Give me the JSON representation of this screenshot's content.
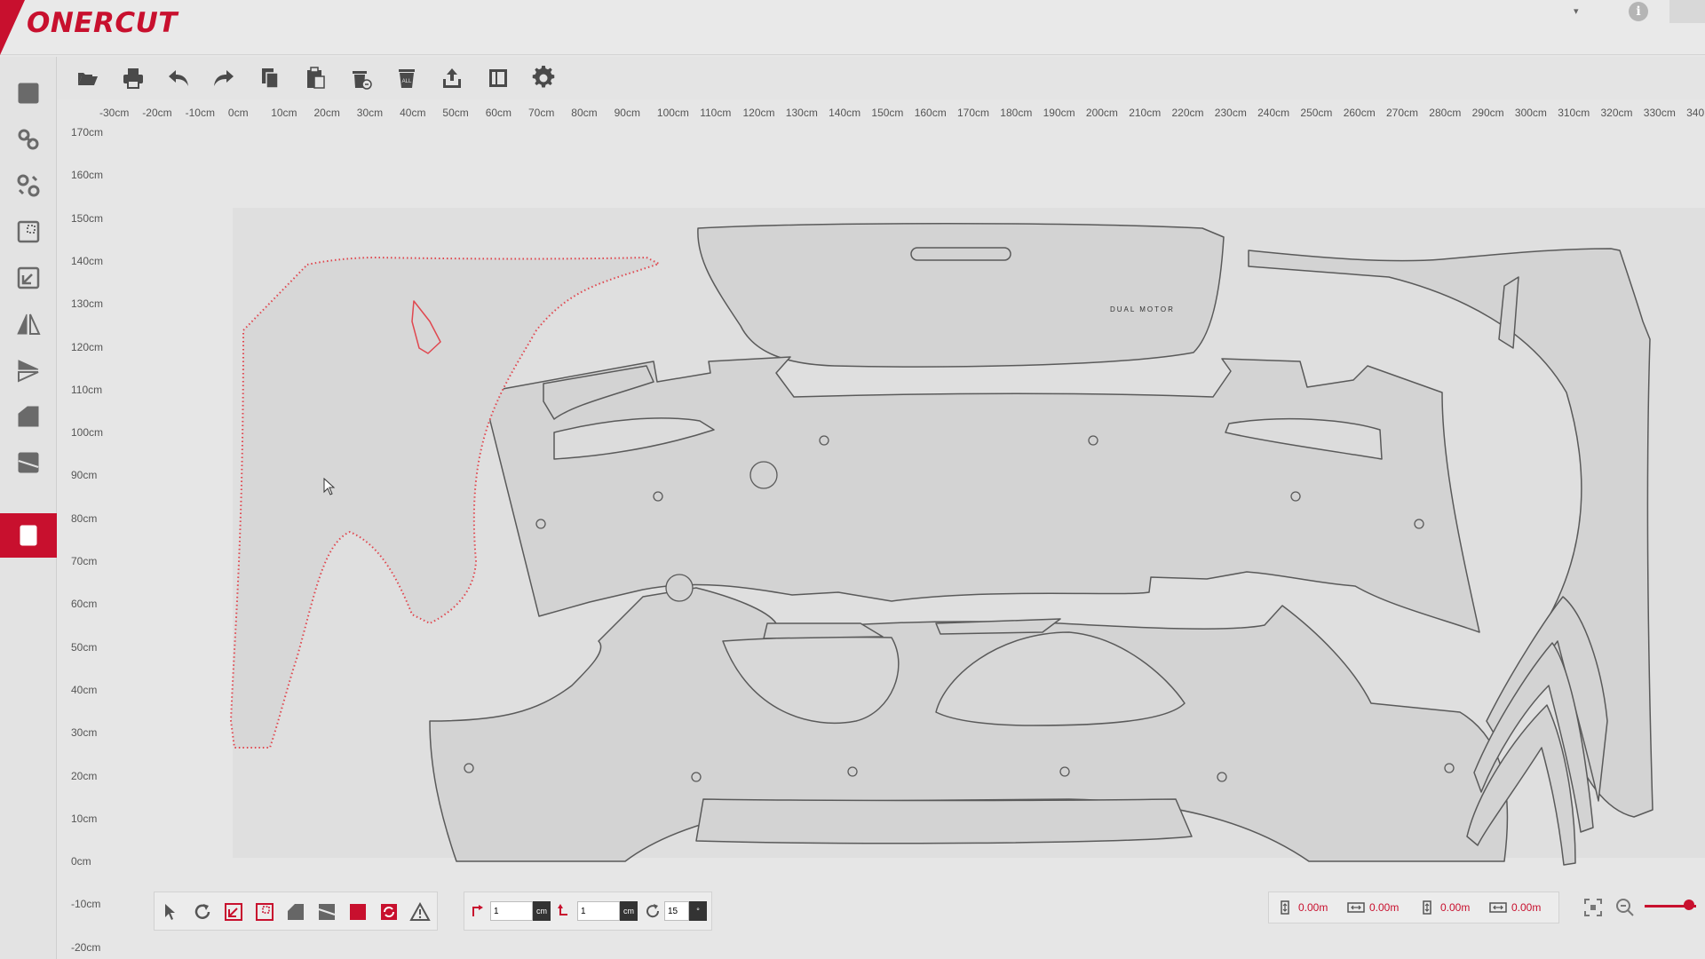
{
  "app": {
    "brand": "ONERCUT"
  },
  "header": {
    "caret": "▾",
    "info": "i"
  },
  "toolbar": {
    "items": [
      "open-file",
      "print",
      "undo",
      "redo",
      "copy",
      "paste",
      "delete-selected",
      "delete-all",
      "export",
      "layout",
      "settings"
    ],
    "delete_all_label": "ALL"
  },
  "sidebar": {
    "items": [
      "layer",
      "link",
      "unlink",
      "select-region",
      "resize",
      "mirror",
      "flip",
      "fill",
      "weld",
      "material"
    ],
    "active": "material"
  },
  "ruler": {
    "x_labels": [
      "-30cm",
      "-20cm",
      "-10cm",
      "0cm",
      "10cm",
      "20cm",
      "30cm",
      "40cm",
      "50cm",
      "60cm",
      "70cm",
      "80cm",
      "90cm",
      "100cm",
      "110cm",
      "120cm",
      "130cm",
      "140cm",
      "150cm",
      "160cm",
      "170cm",
      "180cm",
      "190cm",
      "200cm",
      "210cm",
      "220cm",
      "230cm",
      "240cm",
      "250cm",
      "260cm",
      "270cm",
      "280cm",
      "290cm",
      "300cm",
      "310cm",
      "320cm",
      "330cm",
      "340"
    ],
    "y_labels": [
      "170cm",
      "160cm",
      "150cm",
      "140cm",
      "130cm",
      "120cm",
      "110cm",
      "100cm",
      "90cm",
      "80cm",
      "70cm",
      "60cm",
      "50cm",
      "40cm",
      "30cm",
      "20cm",
      "10cm",
      "0cm",
      "-10cm",
      "-20cm"
    ]
  },
  "colors": {
    "accent": "#c8102e",
    "part_fill": "#d3d3d3",
    "part_stroke": "#5a5a5a",
    "selected_stroke": "#e0474f"
  },
  "canvas": {
    "engraved_text": "DUAL MOTOR"
  },
  "bottom_tools": [
    "select-arrow",
    "rotate",
    "scale-fit",
    "scale-box",
    "fill",
    "stripes",
    "material-block",
    "auto-nest",
    "warning"
  ],
  "step": {
    "x_value": "1",
    "x_unit": "cm",
    "y_value": "1",
    "y_unit": "cm",
    "rotate_value": "15",
    "rotate_unit": "°"
  },
  "readouts": {
    "height": "0.00m",
    "width": "0.00m",
    "offset_y": "0.00m",
    "offset_x": "0.00m"
  }
}
